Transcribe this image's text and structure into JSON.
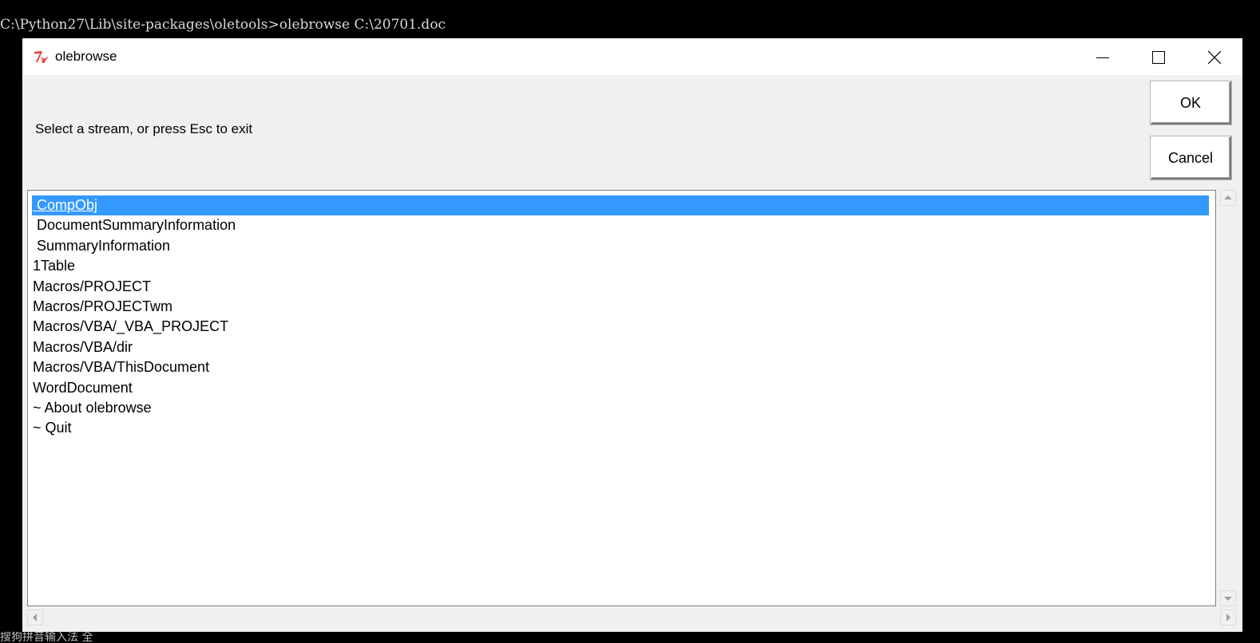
{
  "console": {
    "command_line": "C:\\Python27\\Lib\\site-packages\\oletools>olebrowse C:\\20701.doc",
    "ime_status": "搜狗拼音输入法 全"
  },
  "window": {
    "title": "olebrowse",
    "icon": "tk-feather-icon"
  },
  "dialog": {
    "prompt": "Select a stream, or press Esc to exit",
    "ok_label": "OK",
    "cancel_label": "Cancel"
  },
  "streams": {
    "selected_index": 0,
    "items": [
      " CompObj",
      " DocumentSummaryInformation",
      " SummaryInformation",
      "1Table",
      "Macros/PROJECT",
      "Macros/PROJECTwm",
      "Macros/VBA/_VBA_PROJECT",
      "Macros/VBA/dir",
      "Macros/VBA/ThisDocument",
      "WordDocument",
      "~ About olebrowse",
      "~ Quit"
    ]
  },
  "colors": {
    "selection": "#3399ff",
    "tk_icon": "#e8312f"
  }
}
